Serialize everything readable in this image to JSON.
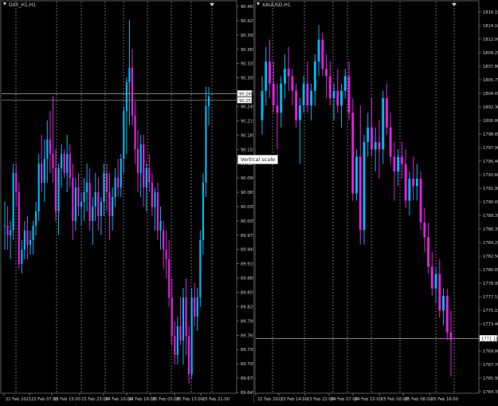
{
  "colors": {
    "background": "#000000",
    "bull": "#00b6f0",
    "bear": "#e020e0",
    "grid": "#cfcfcf",
    "axis_text": "#cfcfcf",
    "price_line": "#9fb2b2"
  },
  "tooltip": {
    "label": "Vertical scale"
  },
  "charts": [
    {
      "id": "dxy",
      "title": "DXY_H1,H1",
      "price_labels": [
        "90.455",
        "90.425",
        "90.395",
        "90.365",
        "90.335",
        "90.305",
        "90.275",
        "90.245",
        "90.215",
        "90.185",
        "90.155",
        "90.125",
        "90.095",
        "90.065",
        "90.035",
        "90.005",
        "89.975",
        "89.945",
        "89.915",
        "89.885",
        "89.855",
        "89.825",
        "89.795",
        "89.765",
        "89.735",
        "89.705",
        "89.675",
        "89.645"
      ],
      "time_labels": [
        "22 Feb 2021",
        "23 Feb 07:00",
        "23 Feb 15:00",
        "23 Feb 23:00",
        "24 Feb 10:00",
        "24 Feb 18:00",
        "25 Feb 05:00",
        "25 Feb 13:00",
        "25 Feb 21:00"
      ],
      "marker_labels": [
        "90.266",
        "90.252"
      ],
      "chart_data": {
        "type": "candlestick",
        "title": "DXY_H1,H1",
        "ylim": [
          89.64,
          90.46
        ],
        "price_lines": [
          90.266,
          90.252
        ],
        "ohlc": [
          [
            89.99,
            90.04,
            89.94,
            89.99
          ],
          [
            89.99,
            90.03,
            89.94,
            89.97
          ],
          [
            89.97,
            90.0,
            89.92,
            89.98
          ],
          [
            89.98,
            90.12,
            89.96,
            90.1
          ],
          [
            90.1,
            90.12,
            90.03,
            90.06
          ],
          [
            90.06,
            90.08,
            89.9,
            89.91
          ],
          [
            89.91,
            89.96,
            89.89,
            89.94
          ],
          [
            89.94,
            90.0,
            89.92,
            89.98
          ],
          [
            89.98,
            90.01,
            89.92,
            89.95
          ],
          [
            89.95,
            89.98,
            89.93,
            89.96
          ],
          [
            89.96,
            90.0,
            89.93,
            89.99
          ],
          [
            89.99,
            90.04,
            89.97,
            90.02
          ],
          [
            90.02,
            90.14,
            90.0,
            90.12
          ],
          [
            90.12,
            90.18,
            90.06,
            90.08
          ],
          [
            90.08,
            90.17,
            90.04,
            90.13
          ],
          [
            90.13,
            90.21,
            90.08,
            90.17
          ],
          [
            90.17,
            90.23,
            90.1,
            90.14
          ],
          [
            90.14,
            90.26,
            90.08,
            90.11
          ],
          [
            90.11,
            90.15,
            90.0,
            90.02
          ],
          [
            90.02,
            90.12,
            89.97,
            90.11
          ],
          [
            90.11,
            90.16,
            90.07,
            90.14
          ],
          [
            90.14,
            90.15,
            90.09,
            90.1
          ],
          [
            90.1,
            90.18,
            90.06,
            90.14
          ],
          [
            90.14,
            90.16,
            90.07,
            90.09
          ],
          [
            90.09,
            90.12,
            89.96,
            90.0
          ],
          [
            90.0,
            90.09,
            89.98,
            90.07
          ],
          [
            90.07,
            90.1,
            90.01,
            90.03
          ],
          [
            90.03,
            90.06,
            89.99,
            90.04
          ],
          [
            90.04,
            90.09,
            90.0,
            90.06
          ],
          [
            90.06,
            90.12,
            90.02,
            90.08
          ],
          [
            90.08,
            90.11,
            89.98,
            90.0
          ],
          [
            90.0,
            90.05,
            89.95,
            90.03
          ],
          [
            90.03,
            90.1,
            90.0,
            90.06
          ],
          [
            90.06,
            90.09,
            89.98,
            90.01
          ],
          [
            90.01,
            90.05,
            89.97,
            90.04
          ],
          [
            90.04,
            90.12,
            90.01,
            90.1
          ],
          [
            90.1,
            90.12,
            90.02,
            90.06
          ],
          [
            90.06,
            90.1,
            89.96,
            90.01
          ],
          [
            90.01,
            90.07,
            89.98,
            90.05
          ],
          [
            90.05,
            90.11,
            90.03,
            90.09
          ],
          [
            90.09,
            90.13,
            90.05,
            90.07
          ],
          [
            90.07,
            90.14,
            90.05,
            90.13
          ],
          [
            90.13,
            90.24,
            90.1,
            90.23
          ],
          [
            90.23,
            90.3,
            90.14,
            90.29
          ],
          [
            90.29,
            90.42,
            90.2,
            90.32
          ],
          [
            90.32,
            90.36,
            90.2,
            90.22
          ],
          [
            90.22,
            90.25,
            90.12,
            90.15
          ],
          [
            90.15,
            90.19,
            90.06,
            90.1
          ],
          [
            90.1,
            90.18,
            90.05,
            90.16
          ],
          [
            90.16,
            90.18,
            90.03,
            90.07
          ],
          [
            90.07,
            90.12,
            90.02,
            90.11
          ],
          [
            90.11,
            90.14,
            90.06,
            90.08
          ],
          [
            90.08,
            90.1,
            90.01,
            90.03
          ],
          [
            90.03,
            90.07,
            89.98,
            90.06
          ],
          [
            90.06,
            90.08,
            89.96,
            89.98
          ],
          [
            89.98,
            90.03,
            89.94,
            90.0
          ],
          [
            89.98,
            90.0,
            89.9,
            89.94
          ],
          [
            89.94,
            89.98,
            89.88,
            89.92
          ],
          [
            89.92,
            89.96,
            89.82,
            89.84
          ],
          [
            89.84,
            89.88,
            89.74,
            89.76
          ],
          [
            89.76,
            89.79,
            89.7,
            89.72
          ],
          [
            89.72,
            89.8,
            89.7,
            89.78
          ],
          [
            89.78,
            89.84,
            89.74,
            89.75
          ],
          [
            89.75,
            89.86,
            89.7,
            89.84
          ],
          [
            89.84,
            89.88,
            89.72,
            89.76
          ],
          [
            89.76,
            89.78,
            89.66,
            89.68
          ],
          [
            89.68,
            89.86,
            89.67,
            89.84
          ],
          [
            89.84,
            89.87,
            89.78,
            89.8
          ],
          [
            89.8,
            89.86,
            89.77,
            89.84
          ],
          [
            89.84,
            89.98,
            89.82,
            89.96
          ],
          [
            89.96,
            90.1,
            89.93,
            90.08
          ],
          [
            90.08,
            90.28,
            90.05,
            90.24
          ],
          [
            90.24,
            90.28,
            90.2,
            90.26
          ]
        ]
      }
    },
    {
      "id": "xau",
      "title": "XAUUSD,H1",
      "price_labels": [
        "1816.15",
        "1814.10",
        "1812.00",
        "1809.25",
        "1807.80",
        "1805.75",
        "1804.05",
        "1802.30",
        "1800.80",
        "1798.85",
        "1797.00",
        "1795.40",
        "1793.60",
        "1791.95",
        "1790.05",
        "1788.35",
        "1786.35",
        "1784.25",
        "1782.50",
        "1780.85",
        "1778.95",
        "1777.15",
        "1775.15",
        "1773.40",
        "1771.65",
        "1769.80",
        "1767.70",
        "1765.95",
        "1764.35"
      ],
      "time_labels": [
        "22 Feb 2021",
        "23 Feb 14:00",
        "23 Feb 22:00",
        "24 Feb 07:00",
        "24 Feb 15:00",
        "25 Feb 00:00",
        "25 Feb 08:00",
        "25 Feb 16:00"
      ],
      "marker_labels": [
        "1771.18"
      ],
      "chart_data": {
        "type": "candlestick",
        "title": "XAUUSD,H1",
        "ylim": [
          1763.7,
          1817.3
        ],
        "price_lines": [
          1771.18
        ],
        "ohlc": [
          [
            1801,
            1807,
            1799,
            1805
          ],
          [
            1805,
            1811,
            1803,
            1809
          ],
          [
            1809,
            1812,
            1804,
            1806
          ],
          [
            1806,
            1809,
            1802,
            1803
          ],
          [
            1803,
            1806,
            1797,
            1802
          ],
          [
            1802,
            1807,
            1800,
            1806
          ],
          [
            1806,
            1810,
            1804,
            1808
          ],
          [
            1808,
            1811,
            1805,
            1807
          ],
          [
            1807,
            1808,
            1803,
            1805
          ],
          [
            1805,
            1806,
            1800,
            1801
          ],
          [
            1801,
            1804,
            1795,
            1803
          ],
          [
            1803,
            1807,
            1802,
            1806
          ],
          [
            1806,
            1809,
            1802,
            1803
          ],
          [
            1803,
            1806,
            1801,
            1805
          ],
          [
            1805,
            1810,
            1803,
            1809
          ],
          [
            1809,
            1814,
            1807,
            1812
          ],
          [
            1812,
            1813,
            1807,
            1808
          ],
          [
            1808,
            1810,
            1804,
            1807
          ],
          [
            1807,
            1809,
            1803,
            1804
          ],
          [
            1804,
            1806,
            1801,
            1805
          ],
          [
            1805,
            1808,
            1802,
            1803
          ],
          [
            1803,
            1806,
            1800,
            1805
          ],
          [
            1805,
            1808,
            1804,
            1807
          ],
          [
            1807,
            1809,
            1801,
            1802
          ],
          [
            1802,
            1804,
            1790,
            1791
          ],
          [
            1791,
            1797,
            1790,
            1796
          ],
          [
            1796,
            1803,
            1784,
            1786
          ],
          [
            1786,
            1799,
            1784,
            1798
          ],
          [
            1798,
            1802,
            1796,
            1800
          ],
          [
            1800,
            1804,
            1796,
            1797
          ],
          [
            1797,
            1800,
            1794,
            1798
          ],
          [
            1798,
            1801,
            1793,
            1797
          ],
          [
            1797,
            1805,
            1795,
            1804
          ],
          [
            1804,
            1806,
            1799,
            1800
          ],
          [
            1800,
            1802,
            1795,
            1796
          ],
          [
            1796,
            1798,
            1790,
            1794
          ],
          [
            1794,
            1797,
            1792,
            1796
          ],
          [
            1796,
            1798,
            1793,
            1795
          ],
          [
            1795,
            1797,
            1789,
            1790
          ],
          [
            1790,
            1794,
            1788,
            1793
          ],
          [
            1793,
            1796,
            1790,
            1792
          ],
          [
            1792,
            1795,
            1790,
            1793
          ],
          [
            1793,
            1794,
            1786,
            1787
          ],
          [
            1787,
            1789,
            1783,
            1785
          ],
          [
            1785,
            1787,
            1780,
            1781
          ],
          [
            1781,
            1783,
            1777,
            1778
          ],
          [
            1778,
            1781,
            1776,
            1780
          ],
          [
            1780,
            1782,
            1774,
            1775
          ],
          [
            1775,
            1778,
            1773,
            1777
          ],
          [
            1777,
            1778,
            1771,
            1772
          ],
          [
            1772,
            1775,
            1766,
            1771
          ]
        ]
      }
    }
  ]
}
